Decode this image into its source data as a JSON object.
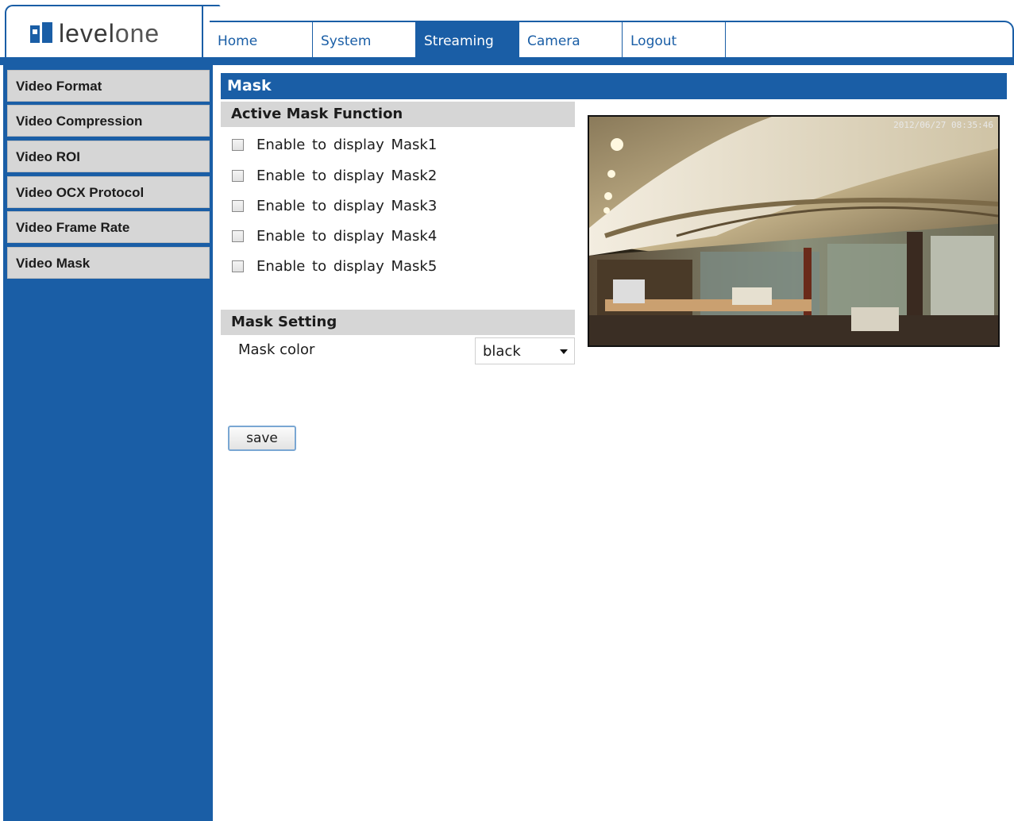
{
  "brand": {
    "logo_text_a": "level",
    "logo_text_b": "one"
  },
  "nav": {
    "tabs": [
      {
        "label": "Home"
      },
      {
        "label": "System"
      },
      {
        "label": "Streaming",
        "active": true
      },
      {
        "label": "Camera"
      },
      {
        "label": "Logout"
      }
    ]
  },
  "sidebar": {
    "items": [
      {
        "label": "Video Format"
      },
      {
        "label": "Video Compression"
      },
      {
        "label": "Video ROI"
      },
      {
        "label": "Video OCX Protocol"
      },
      {
        "label": "Video Frame Rate"
      },
      {
        "label": "Video Mask"
      }
    ]
  },
  "main": {
    "title": "Mask",
    "active_mask": {
      "heading": "Active Mask Function",
      "items": [
        {
          "label": "Enable to display Mask1",
          "checked": false
        },
        {
          "label": "Enable to display Mask2",
          "checked": false
        },
        {
          "label": "Enable to display Mask3",
          "checked": false
        },
        {
          "label": "Enable to display Mask4",
          "checked": false
        },
        {
          "label": "Enable to display Mask5",
          "checked": false
        }
      ]
    },
    "mask_setting": {
      "heading": "Mask Setting",
      "color_label": "Mask color",
      "color_value": "black"
    },
    "save_label": "save",
    "preview": {
      "timestamp": "2012/06/27 08:35:46"
    }
  },
  "colors": {
    "brand_blue": "#1a5ea6",
    "section_gray": "#d6d6d6"
  }
}
